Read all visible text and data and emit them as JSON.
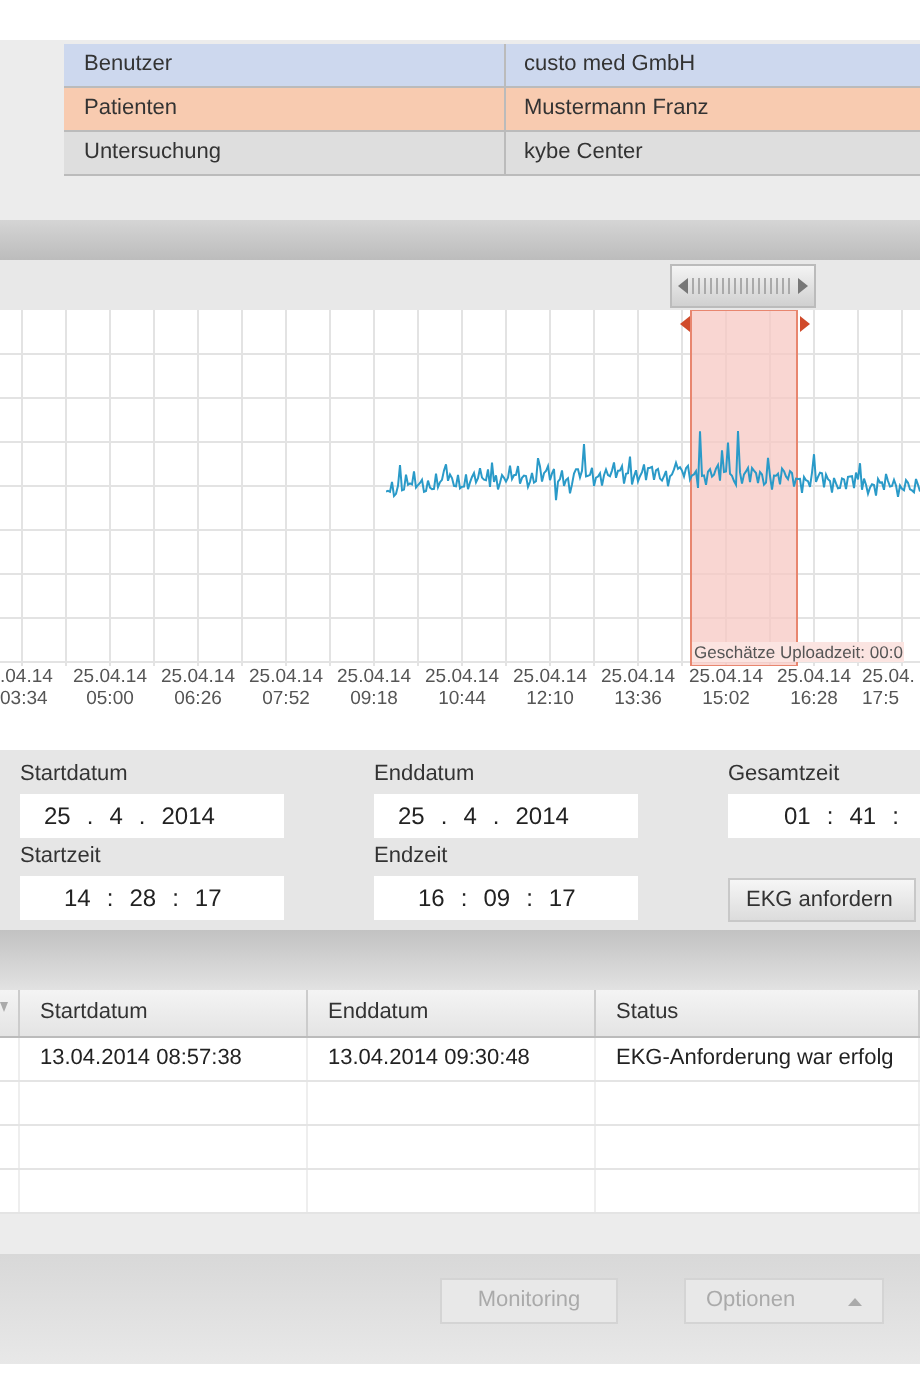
{
  "info_table": {
    "rows": [
      {
        "label": "Benutzer",
        "value": "custo med GmbH",
        "color": "#cdd8ee"
      },
      {
        "label": "Patienten",
        "value": "Mustermann Franz",
        "color": "#f8cbb0"
      },
      {
        "label": "Untersuchung",
        "value": "kybe Center",
        "color": "#dedede"
      }
    ]
  },
  "chart": {
    "upload_time": "Geschätze Uploadzeit: 00:0",
    "x_labels": [
      {
        "date": ".04.14",
        "time": "03:34"
      },
      {
        "date": "25.04.14",
        "time": "05:00"
      },
      {
        "date": "25.04.14",
        "time": "06:26"
      },
      {
        "date": "25.04.14",
        "time": "07:52"
      },
      {
        "date": "25.04.14",
        "time": "09:18"
      },
      {
        "date": "25.04.14",
        "time": "10:44"
      },
      {
        "date": "25.04.14",
        "time": "12:10"
      },
      {
        "date": "25.04.14",
        "time": "13:36"
      },
      {
        "date": "25.04.14",
        "time": "15:02"
      },
      {
        "date": "25.04.14",
        "time": "16:28"
      },
      {
        "date": "25.04.",
        "time": "17:5"
      }
    ]
  },
  "form": {
    "fields": [
      {
        "label": "Startdatum",
        "segments": [
          "25",
          ".",
          "4",
          ".",
          "2014"
        ]
      },
      {
        "label": "Enddatum",
        "segments": [
          "25",
          ".",
          "4",
          ".",
          "2014"
        ]
      },
      {
        "label": "Gesamtzeit",
        "segments": [
          "01",
          ":",
          "41",
          ":"
        ]
      },
      {
        "label": "Startzeit",
        "segments": [
          "14",
          ":",
          "28",
          ":",
          "17"
        ]
      },
      {
        "label": "Endzeit",
        "segments": [
          "16",
          ":",
          "09",
          ":",
          "17"
        ]
      }
    ],
    "button": "EKG anfordern"
  },
  "table": {
    "columns": [
      "Startdatum",
      "Enddatum",
      "Status"
    ],
    "rows": [
      [
        "13.04.2014 08:57:38",
        "13.04.2014 09:30:48",
        "EKG-Anforderung war erfolg"
      ]
    ]
  },
  "buttons": [
    {
      "label": "Monitoring",
      "disabled": true,
      "kind": "plain"
    },
    {
      "label": "Optionen",
      "disabled": true,
      "kind": "menu"
    }
  ]
}
